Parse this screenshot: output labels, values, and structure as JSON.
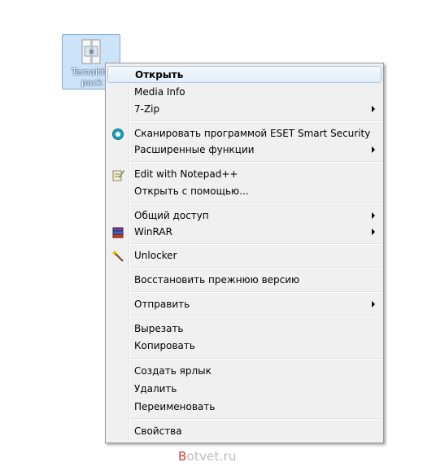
{
  "file": {
    "name": "Temaithe\npack",
    "icon": "archive-file-icon"
  },
  "menu": {
    "items": [
      {
        "label": "Открыть",
        "bold": true,
        "submenu": false,
        "icon": ""
      },
      {
        "label": "Media Info",
        "submenu": false,
        "icon": ""
      },
      {
        "label": "7-Zip",
        "submenu": true,
        "icon": ""
      },
      {
        "label": "Сканировать программой ESET Smart Security",
        "submenu": false,
        "icon": "eset-icon"
      },
      {
        "label": "Расширенные функции",
        "submenu": true,
        "icon": ""
      },
      {
        "label": "Edit with Notepad++",
        "submenu": false,
        "icon": "notepad-icon"
      },
      {
        "label": "Открыть с помощью...",
        "submenu": false,
        "icon": ""
      },
      {
        "label": "Общий доступ",
        "submenu": true,
        "icon": ""
      },
      {
        "label": "WinRAR",
        "submenu": true,
        "icon": "winrar-icon"
      },
      {
        "label": "Unlocker",
        "submenu": false,
        "icon": "unlocker-wand-icon"
      },
      {
        "label": "Восстановить прежнюю версию",
        "submenu": false,
        "icon": ""
      },
      {
        "label": "Отправить",
        "submenu": true,
        "icon": ""
      },
      {
        "label": "Вырезать",
        "submenu": false,
        "icon": ""
      },
      {
        "label": "Копировать",
        "submenu": false,
        "icon": ""
      },
      {
        "label": "Создать ярлык",
        "submenu": false,
        "icon": ""
      },
      {
        "label": "Удалить",
        "submenu": false,
        "icon": ""
      },
      {
        "label": "Переименовать",
        "submenu": false,
        "icon": ""
      },
      {
        "label": "Свойства",
        "submenu": false,
        "icon": ""
      }
    ]
  },
  "watermark": {
    "first": "B",
    "rest": "otvet.ru"
  }
}
